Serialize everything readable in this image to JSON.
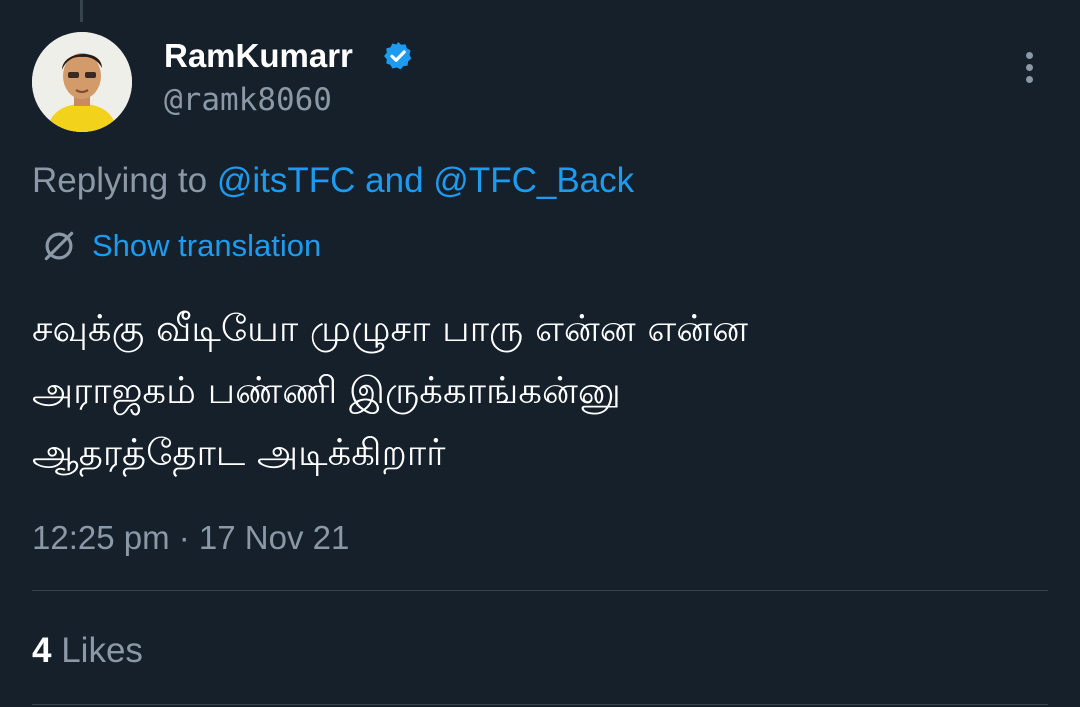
{
  "author": {
    "display_name": "RamKumarr",
    "handle": "@ramk8060",
    "verified_icon": "verified-badge-icon",
    "avatar": "avatar"
  },
  "reply": {
    "prefix": "Replying to",
    "mention_1": "@itsTFC",
    "joiner": "and",
    "mention_2": "@TFC_Back"
  },
  "translation": {
    "label": "Show translation",
    "icon": "translate-globe-icon"
  },
  "tweet": {
    "lines": [
      "சவுக்கு வீடியோ முழுசா பாரு என்ன என்ன",
      "அராஜகம் பண்ணி இருக்காங்கன்னு",
      "ஆதரத்தோட அடிக்கிறார்"
    ]
  },
  "meta": {
    "timestamp": "12:25 pm · 17 Nov 21"
  },
  "stats": {
    "likes_count": "4",
    "likes_label": "Likes"
  },
  "menu": {
    "icon": "more-options-icon"
  },
  "colors": {
    "background": "#15202b",
    "accent": "#1d9bf0",
    "secondary_text": "#8b98a5",
    "divider": "#38444d"
  }
}
